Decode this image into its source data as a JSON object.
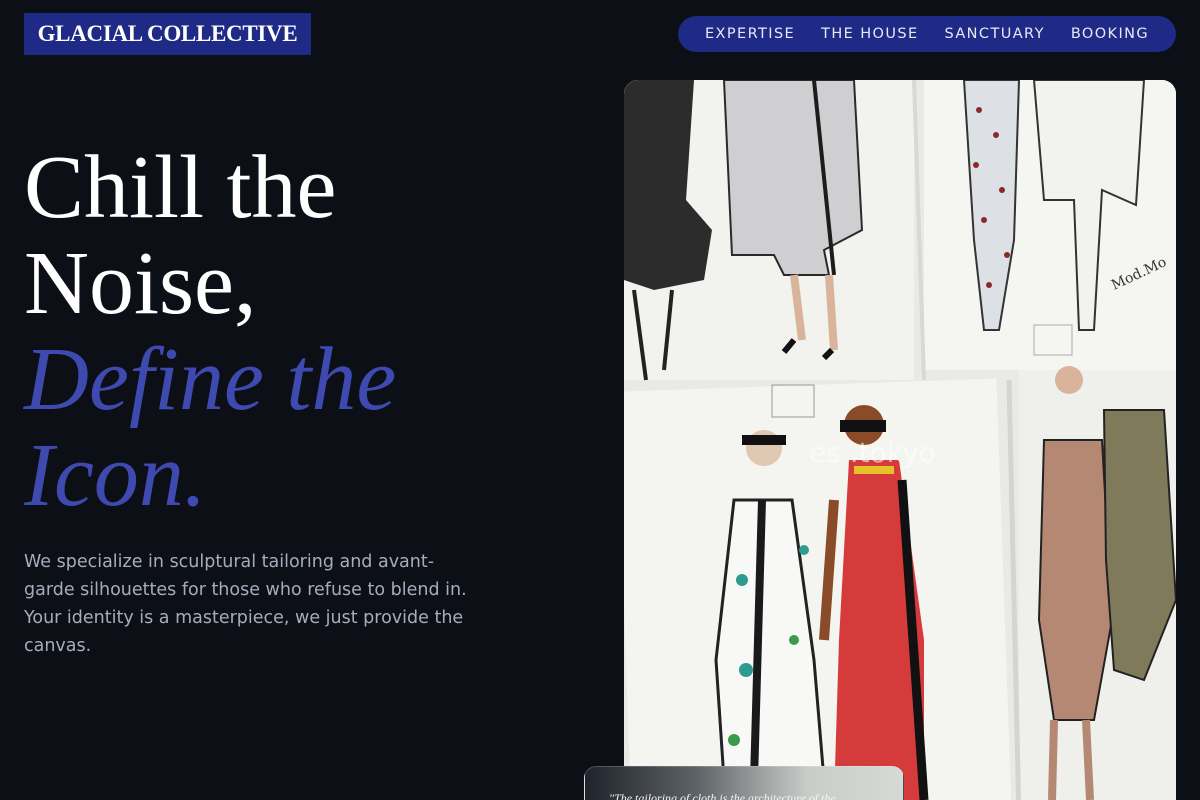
{
  "brand": {
    "name": "GLACIAL COLLECTIVE"
  },
  "nav": {
    "items": [
      {
        "label": "EXPERTISE"
      },
      {
        "label": "THE HOUSE"
      },
      {
        "label": "SANCTUARY"
      },
      {
        "label": "BOOKING"
      }
    ]
  },
  "hero": {
    "headline_line1": "Chill the",
    "headline_line2": "Noise,",
    "headline_accent_line1": "Define the",
    "headline_accent_line2": "Icon.",
    "lead": "We specialize in sculptural tailoring and avant-garde silhouettes for those who refuse to blend in. Your identity is a masterpiece, we just provide the canvas."
  },
  "image": {
    "icon": "fashion-sketches-image"
  },
  "quote": {
    "text": "\"The tailoring of cloth is the architecture of the"
  },
  "colors": {
    "background": "#0c0f16",
    "brand_navy": "#1e2a86",
    "accent": "#3f4ab0",
    "text": "#ffffff",
    "muted": "#a5adbd"
  }
}
